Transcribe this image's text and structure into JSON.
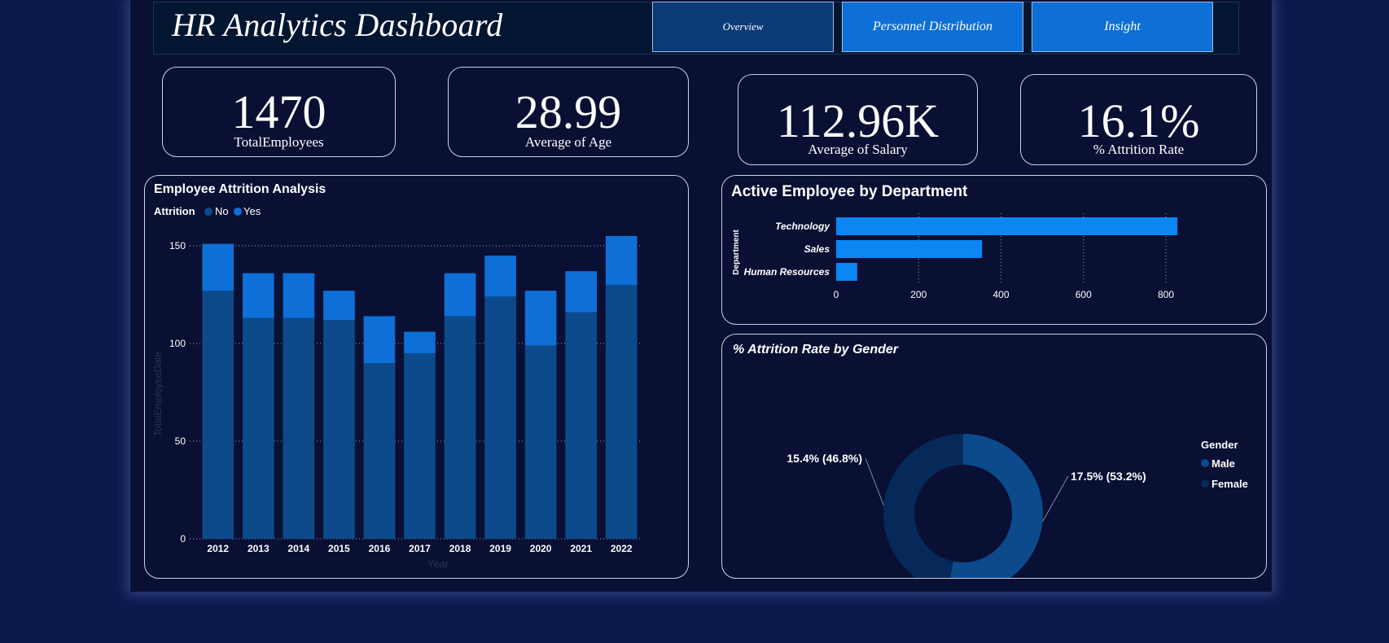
{
  "header": {
    "title": "HR Analytics Dashboard",
    "tabs": [
      {
        "label": "Overview",
        "color": "#0a3a78"
      },
      {
        "label": "Personnel Distribution",
        "color": "#0e6fd6"
      },
      {
        "label": "Insight",
        "color": "#0e6fd6"
      }
    ]
  },
  "kpis": [
    {
      "value": "1470",
      "label": "TotalEmployees"
    },
    {
      "value": "28.99",
      "label": "Average of Age"
    },
    {
      "value": "112.96K",
      "label": "Average of Salary"
    },
    {
      "value": "16.1%",
      "label": "% Attrition Rate"
    }
  ],
  "attrition_chart": {
    "title": "Employee Attrition Analysis",
    "legend_title": "Attrition",
    "colors": {
      "No": "#0c4a8c",
      "Yes": "#0e6fd6"
    }
  },
  "department_chart": {
    "title": "Active Employee by Department",
    "color": "#0b86f2"
  },
  "gender_chart": {
    "title": "% Attrition Rate by Gender",
    "legend_title": "Gender",
    "colors": {
      "Male": "#0c4a8c",
      "Female": "#06295a"
    }
  },
  "chart_data": [
    {
      "type": "bar",
      "stacked": true,
      "title": "Employee Attrition Analysis",
      "xlabel": "Year",
      "ylabel": "TotalEmployeeDate",
      "ylim": [
        0,
        160
      ],
      "yticks": [
        0,
        50,
        100,
        150
      ],
      "grid": true,
      "legend_placement": "top-left",
      "categories": [
        "2012",
        "2013",
        "2014",
        "2015",
        "2016",
        "2017",
        "2018",
        "2019",
        "2020",
        "2021",
        "2022"
      ],
      "series": [
        {
          "name": "No",
          "values": [
            127,
            113,
            113,
            112,
            90,
            95,
            114,
            124,
            99,
            116,
            130
          ]
        },
        {
          "name": "Yes",
          "values": [
            24,
            23,
            23,
            15,
            24,
            11,
            22,
            21,
            28,
            21,
            25
          ]
        }
      ]
    },
    {
      "type": "bar",
      "orientation": "horizontal",
      "title": "Active Employee by Department",
      "ylabel": "Department",
      "xlim": [
        0,
        900
      ],
      "xticks": [
        0,
        200,
        400,
        600,
        800
      ],
      "grid": true,
      "categories": [
        "Technology",
        "Sales",
        "Human Resources"
      ],
      "values": [
        828,
        354,
        51
      ]
    },
    {
      "type": "pie",
      "donut": true,
      "title": "% Attrition Rate by Gender",
      "legend_placement": "right",
      "categories": [
        "Male",
        "Female"
      ],
      "values": [
        17.5,
        15.4
      ],
      "percent_of_total": [
        53.2,
        46.8
      ],
      "labels": [
        "17.5% (53.2%)",
        "15.4% (46.8%)"
      ]
    }
  ]
}
